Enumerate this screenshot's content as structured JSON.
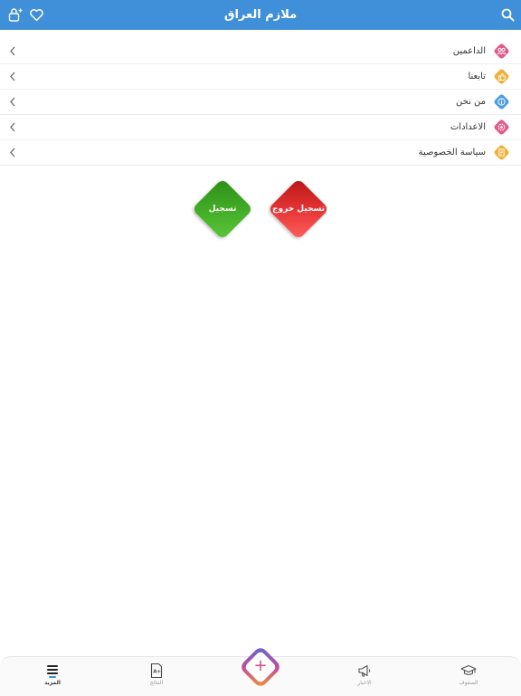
{
  "app": {
    "title": "ملازم العراق"
  },
  "menu": {
    "items": [
      {
        "label": "الداعمين",
        "icon": "supporters-icon",
        "color": "#e05a8a"
      },
      {
        "label": "تابعنا",
        "icon": "follow-us-icon",
        "color": "#f0b13c"
      },
      {
        "label": "من نحن",
        "icon": "about-us-icon",
        "color": "#4a9de0"
      },
      {
        "label": "الاعدادات",
        "icon": "settings-icon",
        "color": "#e05a8a"
      },
      {
        "label": "سياسة الخصوصية",
        "icon": "privacy-policy-icon",
        "color": "#f0b13c"
      }
    ]
  },
  "actions": {
    "logout_label": "تسجيل خروج",
    "register_label": "تسجيل"
  },
  "tabbar": {
    "tabs": [
      {
        "label": "الصفوف",
        "icon": "graduation-cap-icon"
      },
      {
        "label": "الاخبار",
        "icon": "megaphone-icon"
      },
      {
        "label": "النتائج",
        "icon": "grade-document-icon"
      },
      {
        "label": "المزيد",
        "icon": "menu-list-icon",
        "active": true
      }
    ],
    "fab_symbol": "+"
  },
  "colors": {
    "header": "#3f8fd9",
    "logout": "#d92a2a",
    "register": "#3ea522",
    "fab_gradient": [
      "#5b6bd6",
      "#c04a9c",
      "#f39c35"
    ]
  }
}
